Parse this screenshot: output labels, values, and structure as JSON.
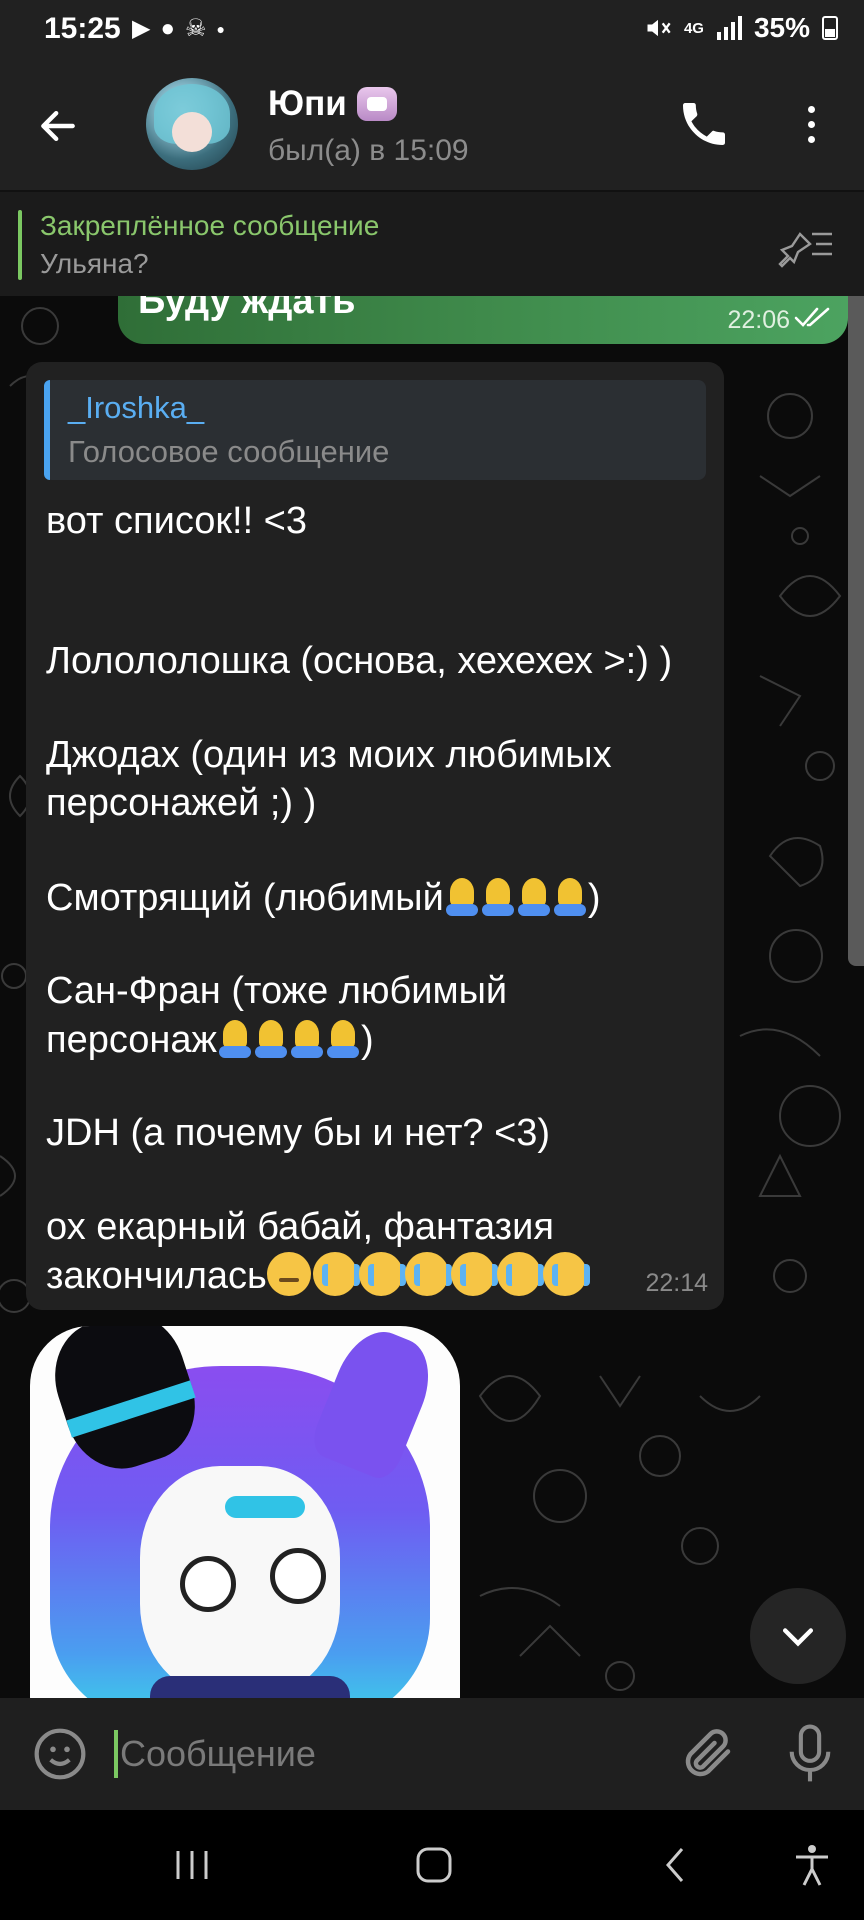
{
  "status_bar": {
    "time": "15:25",
    "network": "4G",
    "battery": "35%"
  },
  "header": {
    "chat_name": "Юпи",
    "last_seen": "был(а) в 15:09"
  },
  "pinned": {
    "title": "Закреплённое сообщение",
    "text": "Ульяна?"
  },
  "messages": {
    "outgoing": {
      "text": "Буду ждать",
      "time": "22:06"
    },
    "incoming": {
      "reply_name": "_Iroshka_",
      "reply_text": "Голосовое сообщение",
      "line1": "вот список!! <3",
      "line2": "Лолололошка (основа, хехехех >:) )",
      "line3": "Джодах (один из моих любимых",
      "line4": "персонажей ;) )",
      "line5": "Смотрящий (любимый",
      "line5_end": ")",
      "line6": "Сан-Фран (тоже любимый",
      "line7": "персонаж",
      "line7_end": ")",
      "line8": "JDH (а почему бы и нет? <3)",
      "line9": "ох екарный бабай, фантазия",
      "line10": "закончилась",
      "time": "22:14"
    }
  },
  "input": {
    "placeholder": "Сообщение"
  },
  "colors": {
    "accent_green": "#7bc862",
    "reply_blue": "#4aa3f0",
    "bubble_incoming": "#212121"
  }
}
